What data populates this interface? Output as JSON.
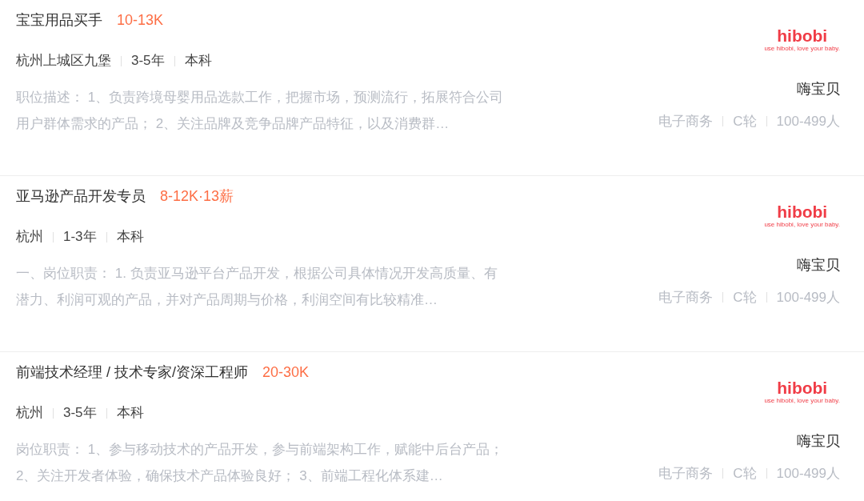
{
  "jobs": [
    {
      "title": "宝宝用品买手",
      "salary": "10-13K",
      "tags": [
        "杭州上城区九堡",
        "3-5年",
        "本科"
      ],
      "description": "职位描述： 1、负责跨境母婴用品选款工作，把握市场，预测流行，拓展符合公司用户群体需求的产品； 2、关注品牌及竞争品牌产品特征，以及消费群…",
      "logo": {
        "name": "hibobi",
        "tagline": "use hibobi, love your baby."
      },
      "company": "嗨宝贝",
      "company_tags": [
        "电子商务",
        "C轮",
        "100-499人"
      ]
    },
    {
      "title": "亚马逊产品开发专员",
      "salary": "8-12K·13薪",
      "tags": [
        "杭州",
        "1-3年",
        "本科"
      ],
      "description": "一、岗位职责： 1. 负责亚马逊平台产品开发，根据公司具体情况开发高质量、有潜力、利润可观的产品，并对产品周期与价格，利润空间有比较精准…",
      "logo": {
        "name": "hibobi",
        "tagline": "use hibobi, love your baby."
      },
      "company": "嗨宝贝",
      "company_tags": [
        "电子商务",
        "C轮",
        "100-499人"
      ]
    },
    {
      "title": "前端技术经理 / 技术专家/资深工程师",
      "salary": "20-30K",
      "tags": [
        "杭州",
        "3-5年",
        "本科"
      ],
      "description": "岗位职责： 1、参与移动技术的产品开发，参与前端架构工作，赋能中后台产品； 2、关注开发者体验，确保技术产品体验良好； 3、前端工程化体系建…",
      "logo": {
        "name": "hibobi",
        "tagline": "use hibobi, love your baby."
      },
      "company": "嗨宝贝",
      "company_tags": [
        "电子商务",
        "C轮",
        "100-499人"
      ]
    }
  ]
}
